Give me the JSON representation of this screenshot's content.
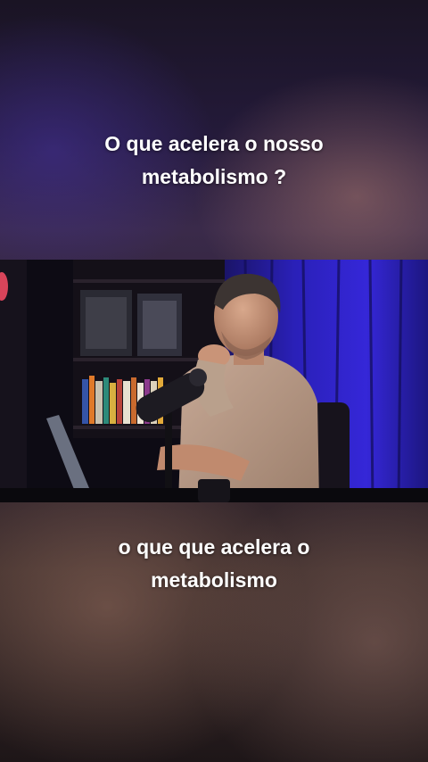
{
  "captions": {
    "top": {
      "line1": "O que acelera o nosso",
      "line2": "metabolismo ?"
    },
    "bottom": {
      "line1": "o que que acelera o",
      "line2": "metabolismo"
    }
  },
  "colors": {
    "curtain": "#2a1fd0",
    "shirt": "#b89a86",
    "background": "#120e1c"
  }
}
